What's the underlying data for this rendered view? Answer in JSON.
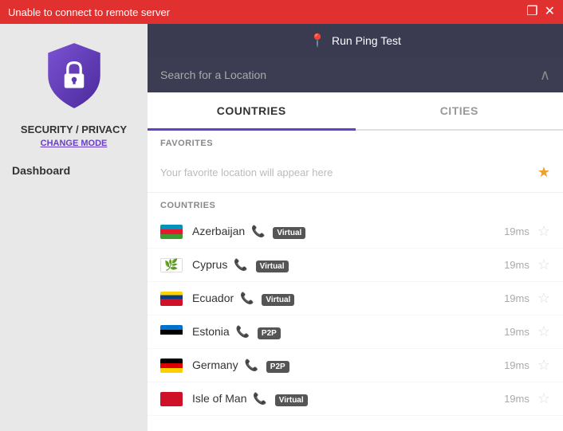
{
  "titlebar": {
    "text": "Unable to connect to remote server",
    "restore_btn": "❐",
    "close_btn": "✕"
  },
  "left_panel": {
    "security_label": "SECURITY / PRIVACY",
    "change_mode": "CHANGE MODE",
    "dashboard_label": "Dashboard"
  },
  "ping_bar": {
    "icon": "📍",
    "text": "Run Ping Test"
  },
  "search_bar": {
    "placeholder": "Search for a Location",
    "chevron": "∧"
  },
  "tabs": [
    {
      "id": "countries",
      "label": "COUNTRIES",
      "active": true
    },
    {
      "id": "cities",
      "label": "CITIES",
      "active": false
    }
  ],
  "favorites": {
    "section_label": "FAVORITES",
    "placeholder_text": "Your favorite location will appear here"
  },
  "countries_section": {
    "label": "COUNTRIES",
    "items": [
      {
        "name": "Azerbaijan",
        "badge": "Virtual",
        "badge_type": "virtual",
        "latency": "19ms",
        "flag": "az"
      },
      {
        "name": "Cyprus",
        "badge": "Virtual",
        "badge_type": "virtual",
        "latency": "19ms",
        "flag": "cy"
      },
      {
        "name": "Ecuador",
        "badge": "Virtual",
        "badge_type": "virtual",
        "latency": "19ms",
        "flag": "ec"
      },
      {
        "name": "Estonia",
        "badge": "P2P",
        "badge_type": "p2p",
        "latency": "19ms",
        "flag": "ee"
      },
      {
        "name": "Germany",
        "badge": "P2P",
        "badge_type": "p2p",
        "latency": "19ms",
        "flag": "de"
      },
      {
        "name": "Isle of Man",
        "badge": "Virtual",
        "badge_type": "virtual",
        "latency": "19ms",
        "flag": "im"
      }
    ]
  }
}
